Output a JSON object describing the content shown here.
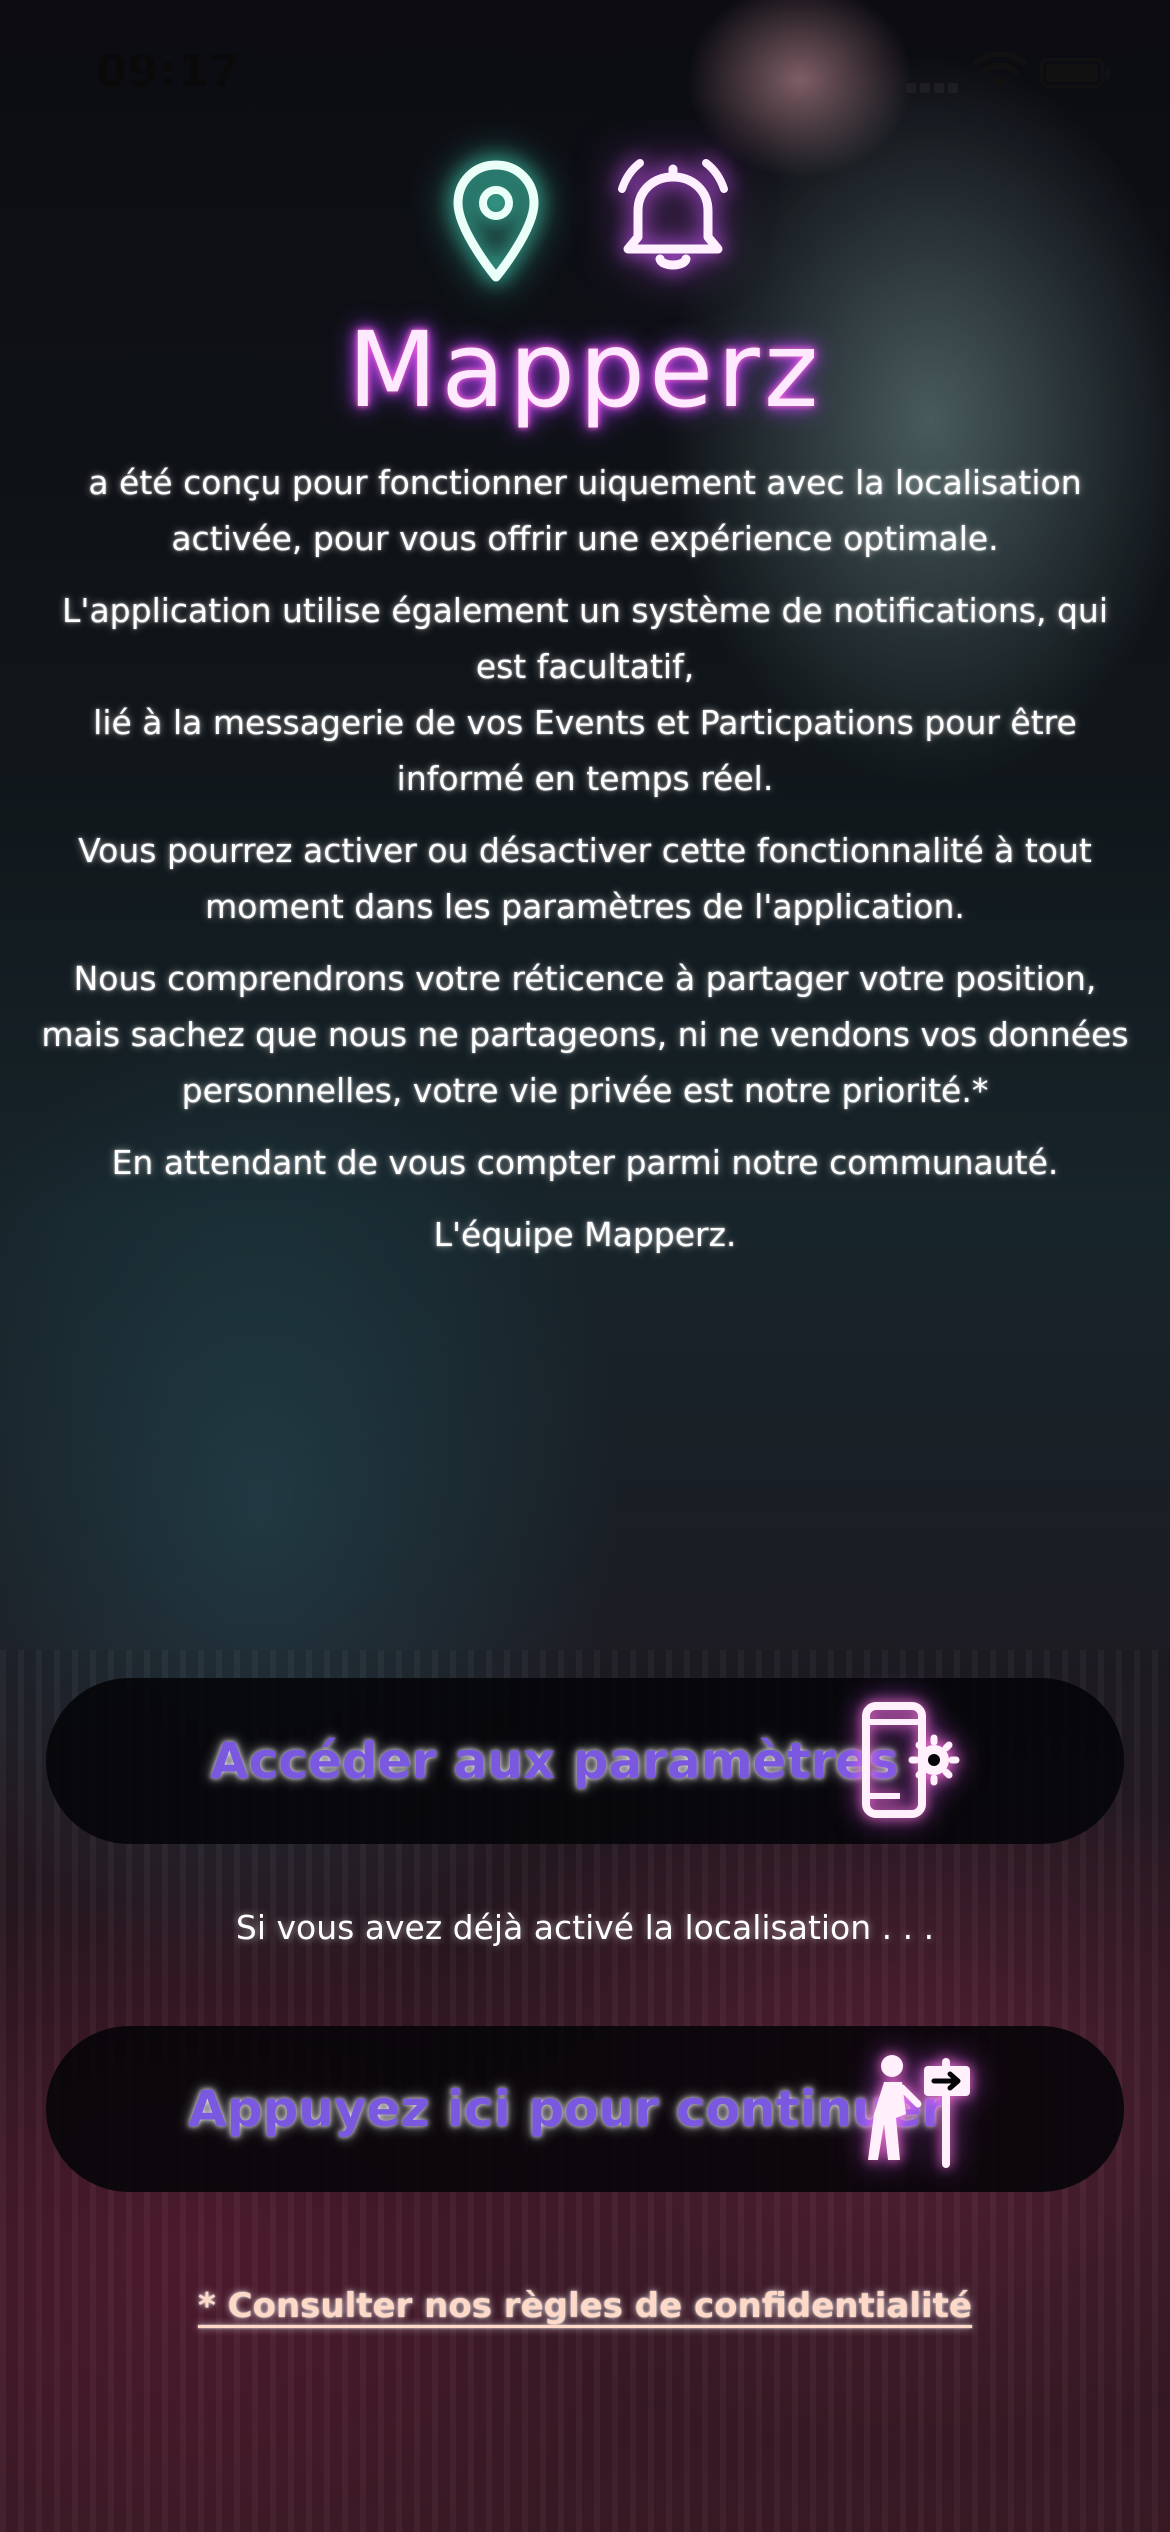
{
  "status_bar": {
    "time": "09:17",
    "icons": [
      "signal-icon",
      "wifi-icon",
      "battery-icon"
    ]
  },
  "header": {
    "icons": [
      "location-pin-icon",
      "notification-bell-icon"
    ],
    "logo_text": "Mapperz"
  },
  "intro": {
    "paragraphs": [
      "a été conçu pour fonctionner uiquement avec la localisation activée, pour vous offrir une expérience optimale.",
      "L'application utilise également un système de notifications, qui est facultatif,\nlié à la messagerie de vos Events et Particpations pour être informé en temps réel.",
      "Vous pourrez activer ou désactiver cette fonctionnalité à tout moment dans les paramètres de l'application.",
      "Nous comprendrons votre réticence à partager votre position, mais sachez que nous ne partageons, ni ne vendons vos données personnelles, votre vie privée est notre priorité.*",
      "En attendant de vous compter parmi notre communauté.",
      "L'équipe Mapperz."
    ]
  },
  "actions": {
    "settings_button": {
      "label": "Accéder aux paramètres",
      "icon": "phone-settings-icon"
    },
    "already_enabled_text": "Si vous avez déjà activé la localisation . . .",
    "continue_button": {
      "label": "Appuyez ici pour continuer",
      "icon": "hiker-signpost-icon"
    }
  },
  "footer": {
    "privacy_link": "* Consulter nos règles de confidentialité"
  },
  "colors": {
    "button_text": "#7a58e0",
    "neon_pink": "#ff6ad5",
    "neon_teal": "#50ffdc",
    "button_bg": "#050508"
  }
}
